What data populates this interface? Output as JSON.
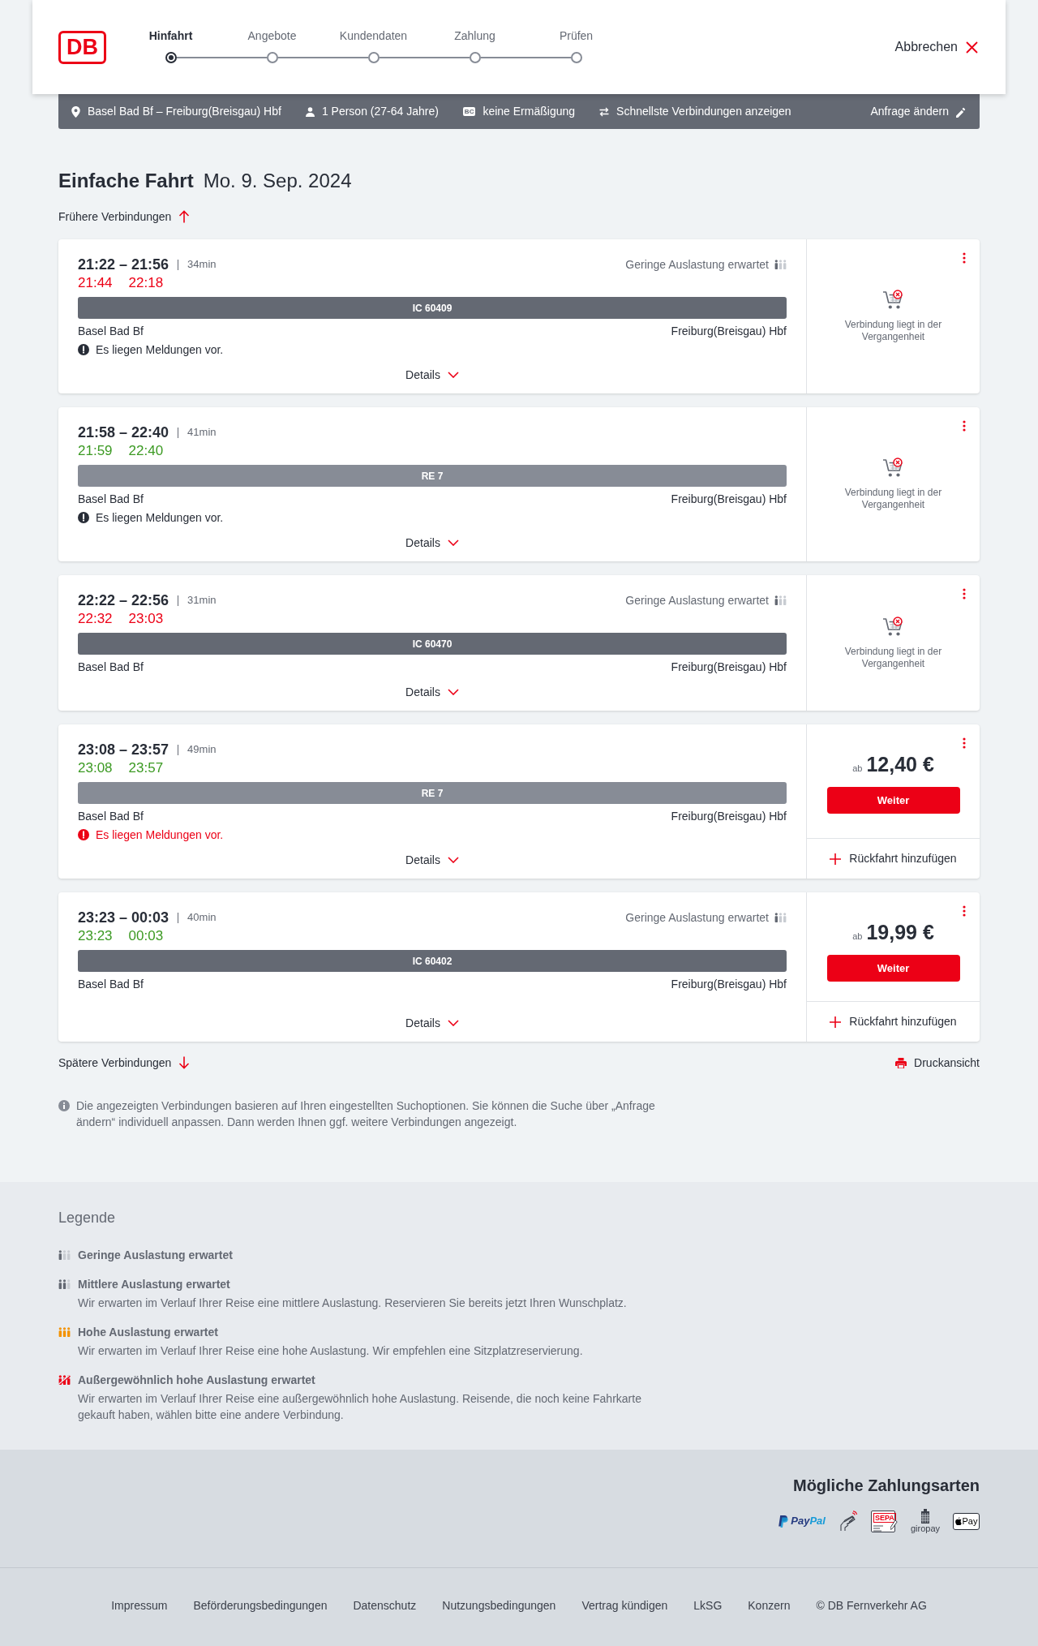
{
  "header": {
    "logo": "DB",
    "steps": [
      {
        "label": "Hinfahrt",
        "selected": true
      },
      {
        "label": "Angebote",
        "selected": false
      },
      {
        "label": "Kundendaten",
        "selected": false
      },
      {
        "label": "Zahlung",
        "selected": false
      },
      {
        "label": "Prüfen",
        "selected": false
      }
    ],
    "cancel": "Abbrechen"
  },
  "search_summary": {
    "route": "Basel Bad Bf – Freiburg(Breisgau) Hbf",
    "passengers": "1 Person (27-64 Jahre)",
    "discount_badge": "BC",
    "discount": "keine Ermäßigung",
    "option": "Schnellste Verbindungen anzeigen",
    "edit": "Anfrage ändern"
  },
  "heading": {
    "title": "Einfache Fahrt",
    "date": "Mo. 9. Sep. 2024"
  },
  "earlier": "Frühere Verbindungen",
  "connections": [
    {
      "times": "21:22 – 21:56",
      "duration": "34min",
      "occupancy": {
        "text": "Geringe Auslastung erwartet",
        "kind": "low"
      },
      "realtime": [
        {
          "time": "21:44",
          "delayed": true
        },
        {
          "time": "22:18",
          "delayed": true
        }
      ],
      "train": {
        "label": "IC 60409",
        "kind": "long-distance"
      },
      "from": "Basel Bad Bf",
      "to": "Freiburg(Breisgau) Hbf",
      "message": {
        "text": "Es liegen Meldungen vor.",
        "important": false
      },
      "details": "Details",
      "offer": {
        "kind": "past",
        "text": "Verbindung liegt in der Vergangenheit"
      }
    },
    {
      "times": "21:58 – 22:40",
      "duration": "41min",
      "realtime": [
        {
          "time": "21:59",
          "delayed": false
        },
        {
          "time": "22:40",
          "delayed": false
        }
      ],
      "train": {
        "label": "RE 7",
        "kind": "regional"
      },
      "from": "Basel Bad Bf",
      "to": "Freiburg(Breisgau) Hbf",
      "message": {
        "text": "Es liegen Meldungen vor.",
        "important": false
      },
      "details": "Details",
      "offer": {
        "kind": "past",
        "text": "Verbindung liegt in der Vergangenheit"
      }
    },
    {
      "times": "22:22 – 22:56",
      "duration": "31min",
      "occupancy": {
        "text": "Geringe Auslastung erwartet",
        "kind": "low"
      },
      "realtime": [
        {
          "time": "22:32",
          "delayed": true
        },
        {
          "time": "23:03",
          "delayed": true
        }
      ],
      "train": {
        "label": "IC 60470",
        "kind": "long-distance"
      },
      "from": "Basel Bad Bf",
      "to": "Freiburg(Breisgau) Hbf",
      "details": "Details",
      "offer": {
        "kind": "past",
        "text": "Verbindung liegt in der Vergangenheit"
      }
    },
    {
      "times": "23:08 – 23:57",
      "duration": "49min",
      "realtime": [
        {
          "time": "23:08",
          "delayed": false
        },
        {
          "time": "23:57",
          "delayed": false
        }
      ],
      "train": {
        "label": "RE 7",
        "kind": "regional"
      },
      "from": "Basel Bad Bf",
      "to": "Freiburg(Breisgau) Hbf",
      "message": {
        "text": "Es liegen Meldungen vor.",
        "important": true
      },
      "details": "Details",
      "offer": {
        "kind": "price",
        "prefix": "ab",
        "price": "12,40 €",
        "button": "Weiter",
        "return": "Rückfahrt hinzufügen"
      }
    },
    {
      "times": "23:23 – 00:03",
      "duration": "40min",
      "occupancy": {
        "text": "Geringe Auslastung erwartet",
        "kind": "low"
      },
      "realtime": [
        {
          "time": "23:23",
          "delayed": false
        },
        {
          "time": "00:03",
          "delayed": false
        }
      ],
      "train": {
        "label": "IC 60402",
        "kind": "long-distance"
      },
      "from": "Basel Bad Bf",
      "to": "Freiburg(Breisgau) Hbf",
      "details": "Details",
      "offer": {
        "kind": "price",
        "prefix": "ab",
        "price": "19,99 €",
        "button": "Weiter",
        "return": "Rückfahrt hinzufügen"
      }
    }
  ],
  "later": "Spätere Verbindungen",
  "print": "Druckansicht",
  "note": "Die angezeigten Verbindungen basieren auf Ihren eingestellten Suchoptionen. Sie können die Suche über „Anfrage ändern“ individuell anpassen. Dann werden Ihnen ggf. weitere Verbindungen angezeigt.",
  "legend": {
    "title": "Legende",
    "items": [
      {
        "kind": "low",
        "title": "Geringe Auslastung erwartet"
      },
      {
        "kind": "medium",
        "title": "Mittlere Auslastung erwartet",
        "description": "Wir erwarten im Verlauf Ihrer Reise eine mittlere Auslastung. Reservieren Sie bereits jetzt Ihren Wunschplatz."
      },
      {
        "kind": "high",
        "title": "Hohe Auslastung erwartet",
        "description": "Wir erwarten im Verlauf Ihrer Reise eine hohe Auslastung. Wir empfehlen eine Sitzplatzreservierung."
      },
      {
        "kind": "exceptional",
        "title": "Außergewöhnlich hohe Auslastung erwartet",
        "description": "Wir erwarten im Verlauf Ihrer Reise eine außergewöhnlich hohe Auslastung. Reisende, die noch keine Fahrkarte gekauft haben, wählen bitte eine andere Verbindung."
      }
    ]
  },
  "payment": {
    "title": "Mögliche Zahlungsarten",
    "methods": [
      {
        "kind": "paypal",
        "label_parts": [
          "Pay",
          "Pal"
        ]
      },
      {
        "kind": "card"
      },
      {
        "kind": "sepa",
        "label": "SEPA"
      },
      {
        "kind": "giropay",
        "label": "giropay"
      },
      {
        "kind": "apple-pay",
        "label": "Pay"
      }
    ]
  },
  "footer": {
    "links": [
      "Impressum",
      "Beförderungsbedingungen",
      "Datenschutz",
      "Nutzungsbedingungen",
      "Vertrag kündigen",
      "LkSG",
      "Konzern"
    ],
    "copyright": "© DB Fernverkehr AG"
  }
}
